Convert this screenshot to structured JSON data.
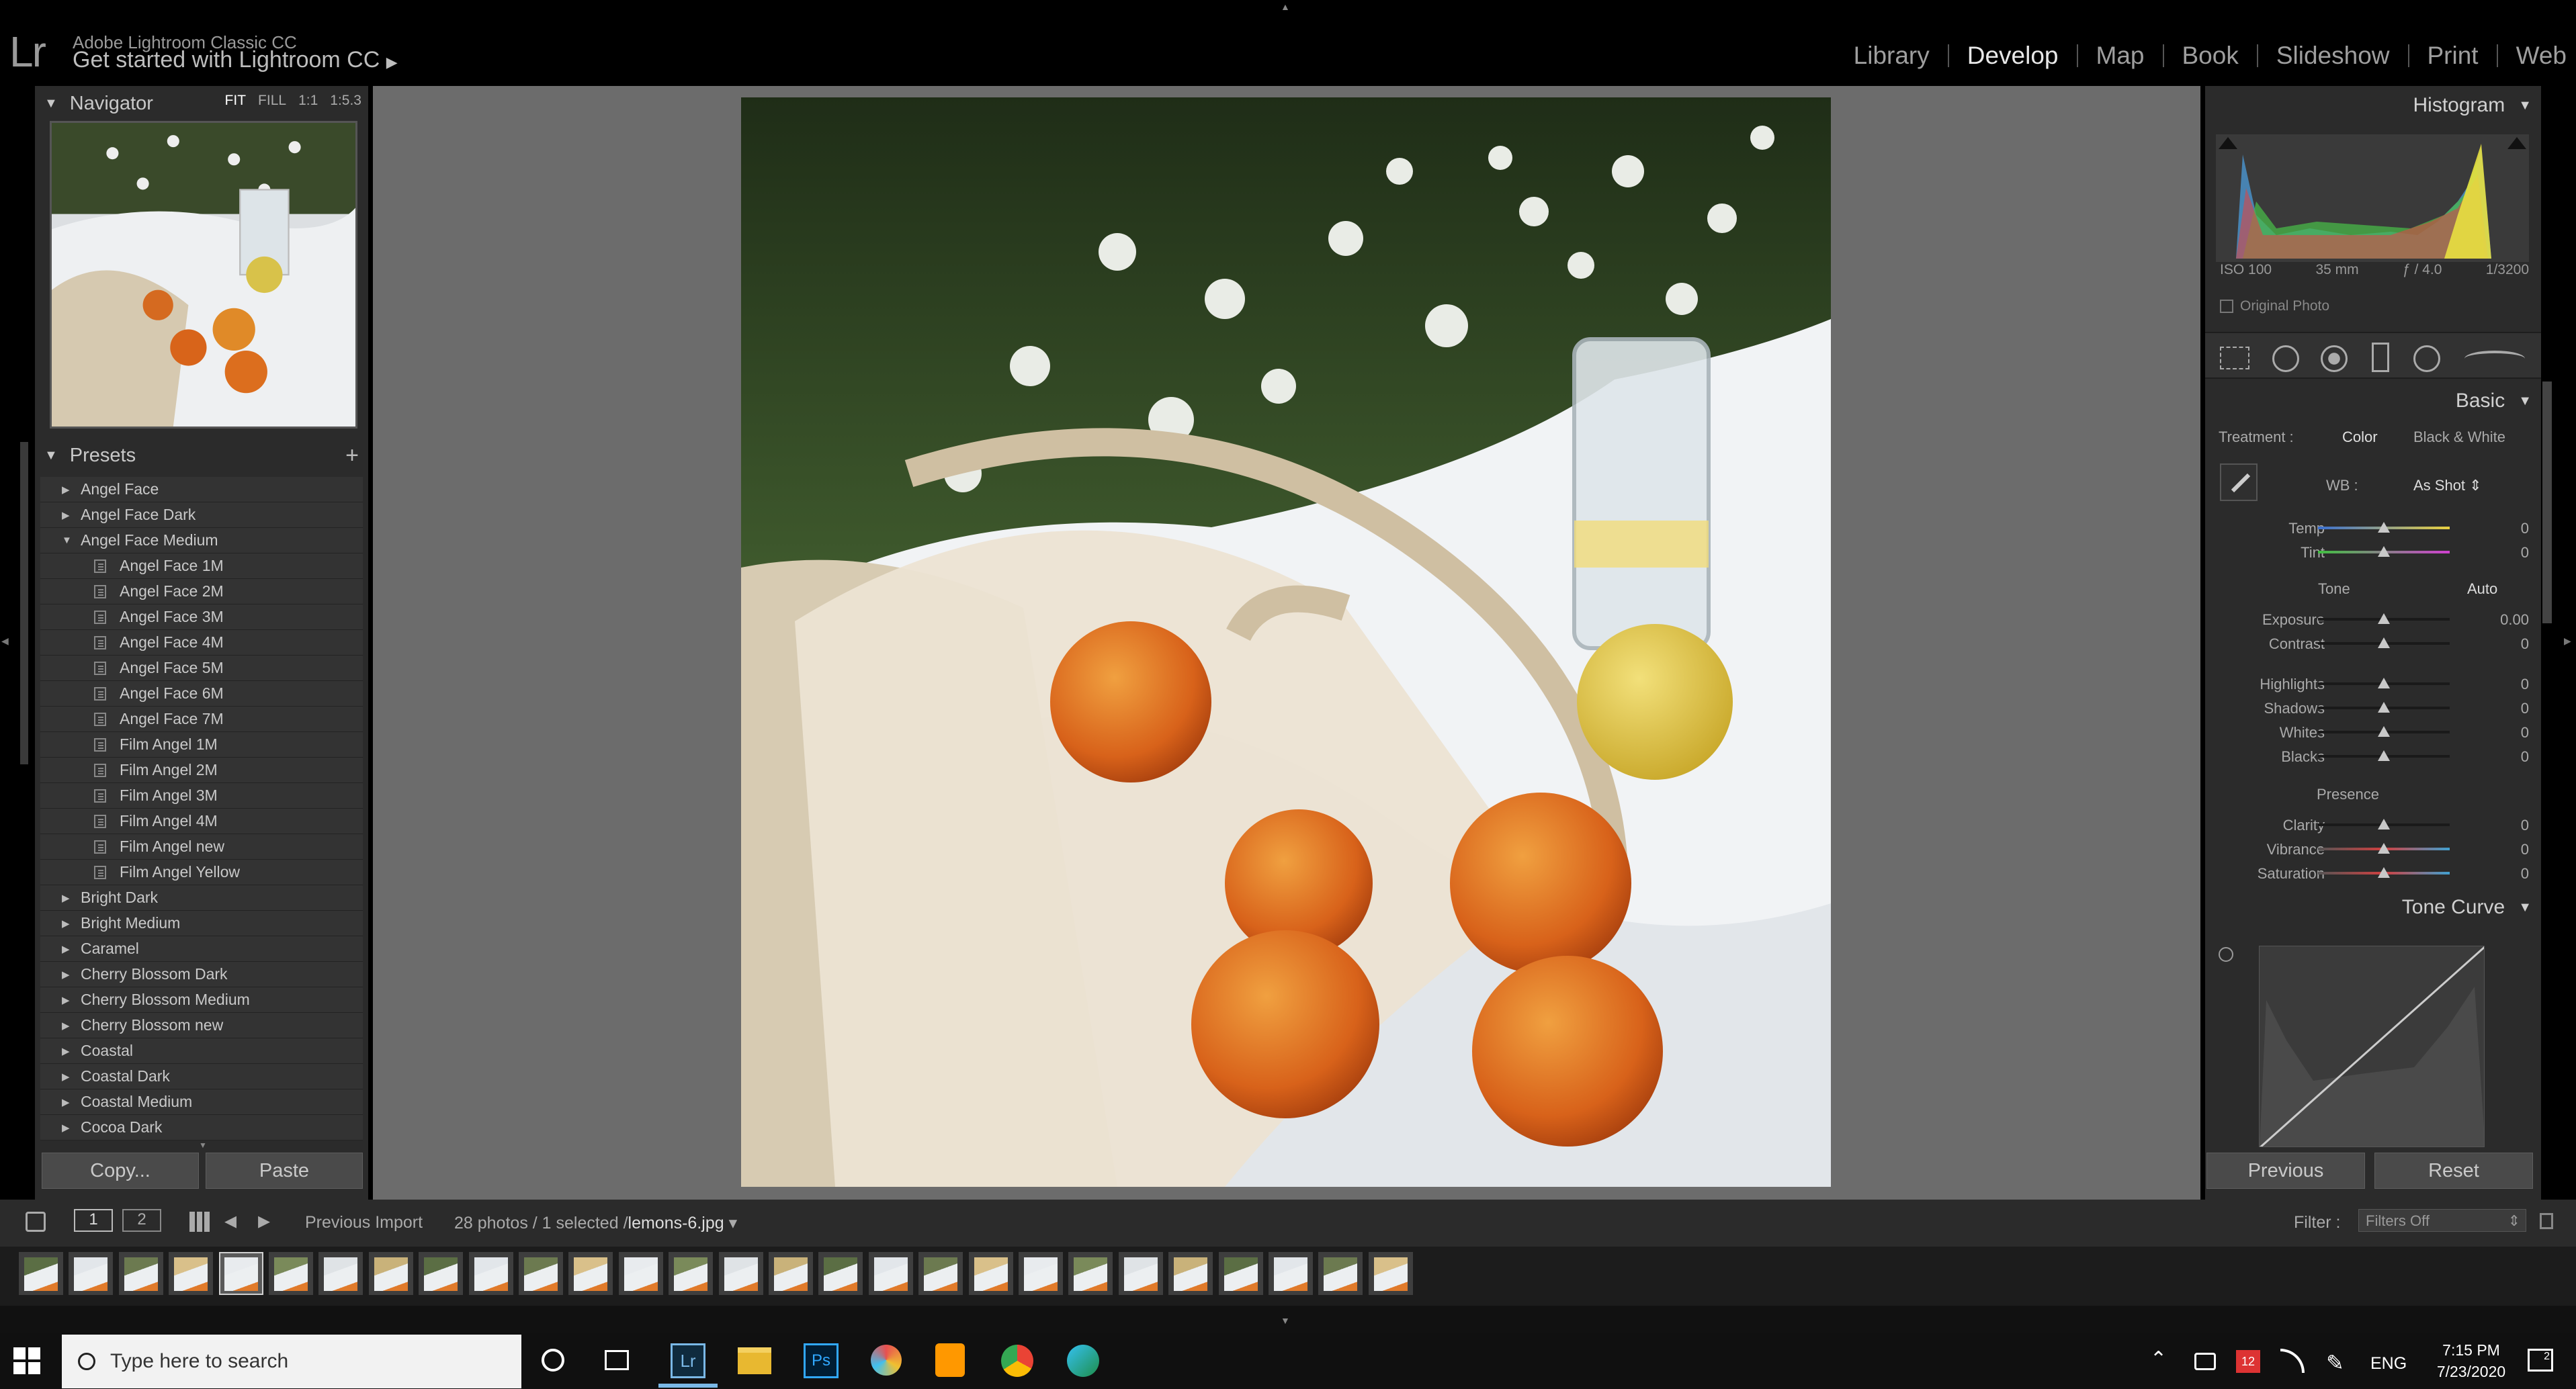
{
  "app": {
    "logo": "Lr",
    "identity_line1": "Adobe Lightroom Classic CC",
    "identity_line2": "Get started with Lightroom CC",
    "modules": [
      "Library",
      "Develop",
      "Map",
      "Book",
      "Slideshow",
      "Print",
      "Web"
    ],
    "active_module": "Develop"
  },
  "left": {
    "navigator": {
      "title": "Navigator",
      "zoom_options": [
        "FIT",
        "FILL",
        "1:1",
        "1:5.3"
      ]
    },
    "presets": {
      "title": "Presets",
      "add": "+",
      "items": [
        {
          "label": "Angel Face",
          "type": "folder"
        },
        {
          "label": "Angel Face Dark",
          "type": "folder"
        },
        {
          "label": "Angel Face Medium",
          "type": "folder-open"
        },
        {
          "label": "Angel Face 1M",
          "type": "preset"
        },
        {
          "label": "Angel Face 2M",
          "type": "preset"
        },
        {
          "label": "Angel Face 3M",
          "type": "preset"
        },
        {
          "label": "Angel Face 4M",
          "type": "preset"
        },
        {
          "label": "Angel Face 5M",
          "type": "preset"
        },
        {
          "label": "Angel Face 6M",
          "type": "preset"
        },
        {
          "label": "Angel Face 7M",
          "type": "preset"
        },
        {
          "label": "Film Angel 1M",
          "type": "preset"
        },
        {
          "label": "Film Angel 2M",
          "type": "preset"
        },
        {
          "label": "Film Angel 3M",
          "type": "preset"
        },
        {
          "label": "Film Angel 4M",
          "type": "preset"
        },
        {
          "label": "Film Angel new",
          "type": "preset"
        },
        {
          "label": "Film Angel Yellow",
          "type": "preset"
        },
        {
          "label": "Bright Dark",
          "type": "folder"
        },
        {
          "label": "Bright Medium",
          "type": "folder"
        },
        {
          "label": "Caramel",
          "type": "folder"
        },
        {
          "label": "Cherry Blossom Dark",
          "type": "folder"
        },
        {
          "label": "Cherry Blossom Medium",
          "type": "folder"
        },
        {
          "label": "Cherry Blossom new",
          "type": "folder"
        },
        {
          "label": "Coastal",
          "type": "folder"
        },
        {
          "label": "Coastal Dark",
          "type": "folder"
        },
        {
          "label": "Coastal Medium",
          "type": "folder"
        },
        {
          "label": "Cocoa Dark",
          "type": "folder"
        }
      ]
    },
    "copy_label": "Copy...",
    "paste_label": "Paste"
  },
  "right": {
    "histogram": {
      "title": "Histogram",
      "iso": "ISO 100",
      "focal": "35 mm",
      "aperture": "ƒ / 4.0",
      "shutter": "1/3200",
      "original_photo": "Original Photo"
    },
    "basic": {
      "title": "Basic",
      "treatment_label": "Treatment :",
      "treatment_color": "Color",
      "treatment_bw": "Black & White",
      "wb_label": "WB :",
      "wb_value": "As Shot",
      "tone_label": "Tone",
      "auto_label": "Auto",
      "presence_label": "Presence",
      "sliders": [
        {
          "label": "Temp",
          "value": "0",
          "level": 0.5
        },
        {
          "label": "Tint",
          "value": "0",
          "level": 0.5
        },
        {
          "label": "Exposure",
          "value": "0.00",
          "level": 0.5
        },
        {
          "label": "Contrast",
          "value": "0",
          "level": 0.5
        },
        {
          "label": "Highlights",
          "value": "0",
          "level": 0.5
        },
        {
          "label": "Shadows",
          "value": "0",
          "level": 0.5
        },
        {
          "label": "Whites",
          "value": "0",
          "level": 0.5
        },
        {
          "label": "Blacks",
          "value": "0",
          "level": 0.5
        },
        {
          "label": "Clarity",
          "value": "0",
          "level": 0.5
        },
        {
          "label": "Vibrance",
          "value": "0",
          "level": 0.5
        },
        {
          "label": "Saturation",
          "value": "0",
          "level": 0.5
        }
      ]
    },
    "tone_curve": {
      "title": "Tone Curve"
    },
    "previous_label": "Previous",
    "reset_label": "Reset"
  },
  "filmstrip": {
    "page1": "1",
    "page2": "2",
    "source": "Previous Import",
    "count": "28 photos / 1 selected /",
    "filename": "lemons-6.jpg",
    "filter_label": "Filter :",
    "filter_value": "Filters Off",
    "thumb_count": 28,
    "selected_index": 4
  },
  "taskbar": {
    "search_placeholder": "Type here to search",
    "lang": "ENG",
    "time": "7:15 PM",
    "date": "7/23/2020",
    "notifications": "2",
    "mail_badge": "12"
  },
  "colors": {
    "accent": "#c8c8c8",
    "panel": "#2b2b2b",
    "center": "#6c6c6c"
  }
}
